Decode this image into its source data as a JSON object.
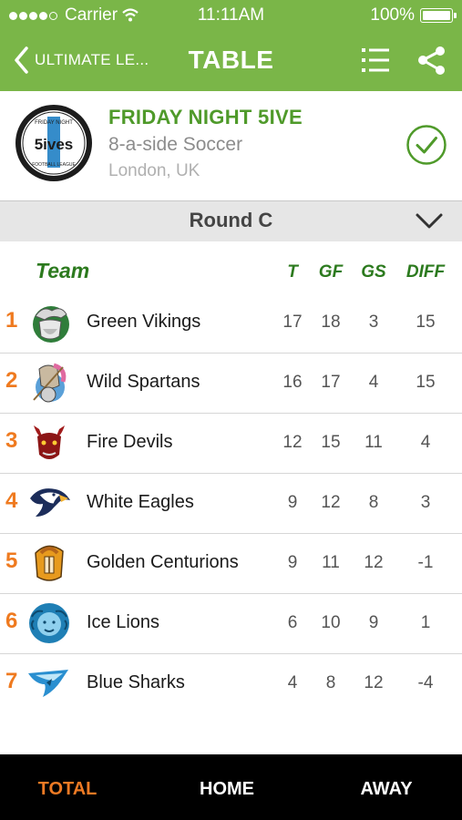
{
  "status_bar": {
    "carrier": "Carrier",
    "time": "11:11AM",
    "battery": "100%"
  },
  "nav": {
    "back_label": "ULTIMATE LE...",
    "title": "TABLE",
    "icons": [
      "back-chevron-icon",
      "list-icon",
      "share-icon"
    ]
  },
  "league": {
    "name": "FRIDAY NIGHT 5IVE",
    "type": "8-a-side Soccer",
    "location": "London, UK",
    "logo_text": "FRIDAY NIGHT 5ives FOOTBALL LEAGUE",
    "followed_icon": "check-circle-icon"
  },
  "round": {
    "label": "Round C",
    "icon": "chevron-down-icon"
  },
  "table": {
    "headers": {
      "team": "Team",
      "t": "T",
      "gf": "GF",
      "gs": "GS",
      "diff": "DIFF"
    },
    "rows": [
      {
        "pos": "1",
        "team": "Green Vikings",
        "t": "17",
        "gf": "18",
        "gs": "3",
        "diff": "15",
        "crest": "viking-crest-icon"
      },
      {
        "pos": "2",
        "team": "Wild Spartans",
        "t": "16",
        "gf": "17",
        "gs": "4",
        "diff": "15",
        "crest": "spartan-crest-icon"
      },
      {
        "pos": "3",
        "team": "Fire Devils",
        "t": "12",
        "gf": "15",
        "gs": "11",
        "diff": "4",
        "crest": "devil-crest-icon"
      },
      {
        "pos": "4",
        "team": "White Eagles",
        "t": "9",
        "gf": "12",
        "gs": "8",
        "diff": "3",
        "crest": "eagle-crest-icon"
      },
      {
        "pos": "5",
        "team": "Golden Centurions",
        "t": "9",
        "gf": "11",
        "gs": "12",
        "diff": "-1",
        "crest": "centurion-crest-icon"
      },
      {
        "pos": "6",
        "team": "Ice Lions",
        "t": "6",
        "gf": "10",
        "gs": "9",
        "diff": "1",
        "crest": "lion-crest-icon"
      },
      {
        "pos": "7",
        "team": "Blue Sharks",
        "t": "4",
        "gf": "8",
        "gs": "12",
        "diff": "-4",
        "crest": "shark-crest-icon"
      }
    ]
  },
  "tabs": [
    {
      "label": "TOTAL",
      "active": true
    },
    {
      "label": "HOME",
      "active": false
    },
    {
      "label": "AWAY",
      "active": false
    }
  ],
  "colors": {
    "brand_green": "#7ab648",
    "header_green": "#2c7a1e",
    "league_green": "#4f9a2a",
    "position_orange": "#ef7a1f",
    "active_tab": "#ee7a24"
  }
}
